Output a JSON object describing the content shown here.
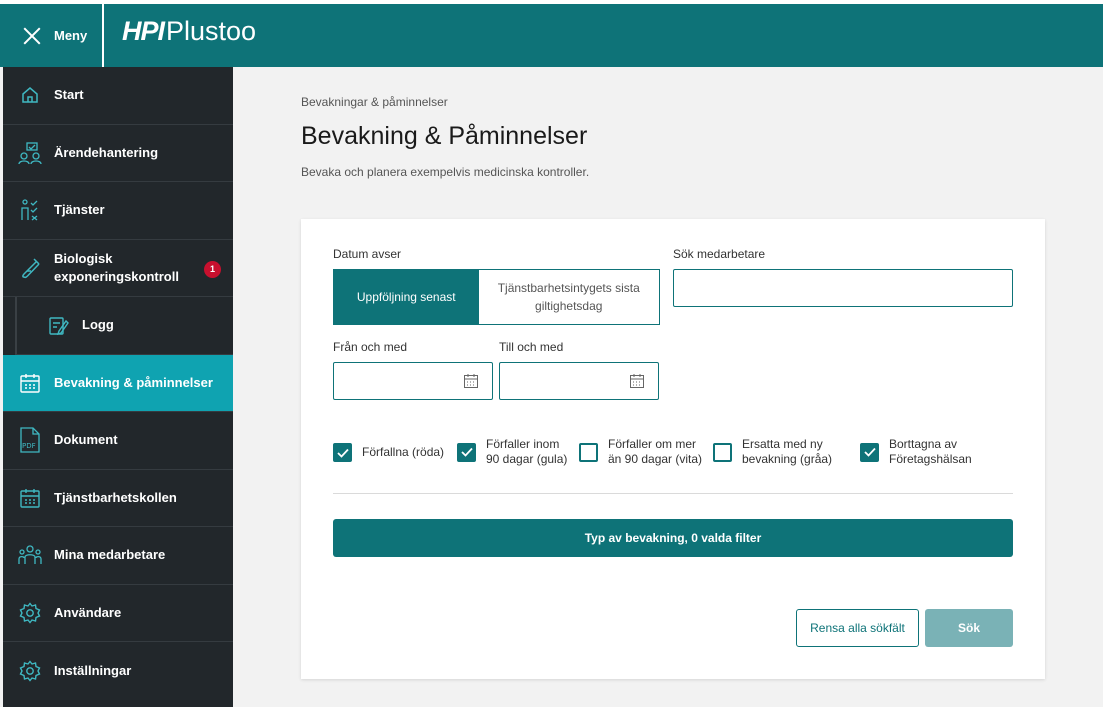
{
  "header": {
    "menu_label": "Meny",
    "logo_hpi": "HPI",
    "logo_plustoo": "Plustoo",
    "brand_color": "#0e7378"
  },
  "sidebar": {
    "items": [
      {
        "label": "Start",
        "icon": "home-icon"
      },
      {
        "label": "Ärendehantering",
        "icon": "case-handling-icon"
      },
      {
        "label": "Tjänster",
        "icon": "services-icon"
      },
      {
        "label": "Biologisk exponeringskontroll",
        "icon": "test-tube-icon",
        "badge": "1"
      },
      {
        "label": "Logg",
        "icon": "log-icon"
      },
      {
        "label": "Bevakning & påminnelser",
        "icon": "calendar-icon",
        "active": true
      },
      {
        "label": "Dokument",
        "icon": "pdf-icon"
      },
      {
        "label": "Tjänstbarhetskollen",
        "icon": "calendar-icon"
      },
      {
        "label": "Mina medarbetare",
        "icon": "people-icon"
      },
      {
        "label": "Användare",
        "icon": "gear-icon"
      },
      {
        "label": "Inställningar",
        "icon": "gear-icon"
      }
    ]
  },
  "main": {
    "breadcrumb": "Bevakningar & påminnelser",
    "title": "Bevakning & Påminnelser",
    "subtitle": "Bevaka och planera exempelvis medicinska kontroller."
  },
  "form": {
    "date_label": "Datum avser",
    "date_options": [
      "Uppföljning senast",
      "Tjänstbarhetsintygets sista giltighetsdag"
    ],
    "search_employee_label": "Sök medarbetare",
    "search_employee_value": "",
    "from_label": "Från och med",
    "from_value": "",
    "to_label": "Till och med",
    "to_value": "",
    "checkboxes": [
      {
        "label": "Förfallna (röda)",
        "checked": true
      },
      {
        "label": "Förfaller inom 90 dagar (gula)",
        "checked": true
      },
      {
        "label": "Förfaller om mer än 90 dagar (vita)",
        "checked": false
      },
      {
        "label": "Ersatta med ny bevakning (gråa)",
        "checked": false
      },
      {
        "label": "Borttagna av Företagshälsan",
        "checked": true
      }
    ],
    "filter_button": "Typ av bevakning, 0 valda filter",
    "clear_button": "Rensa alla sökfält",
    "search_button": "Sök"
  }
}
